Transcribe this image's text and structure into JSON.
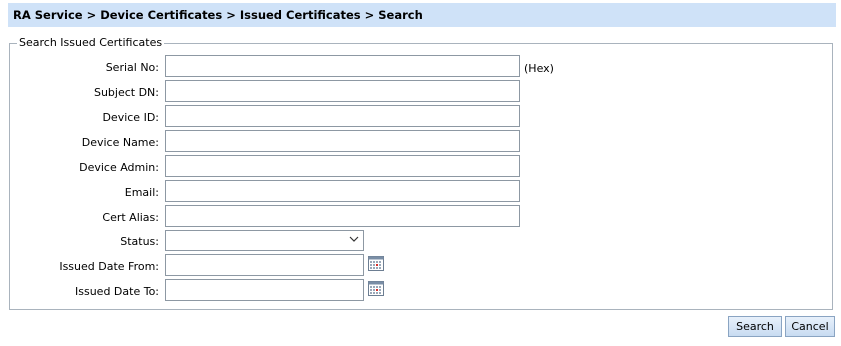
{
  "breadcrumb": "RA Service > Device Certificates > Issued Certificates > Search",
  "form": {
    "legend": "Search Issued Certificates",
    "serial_label": "Serial No:",
    "serial_value": "",
    "hex_note": "(Hex)",
    "subject_label": "Subject DN:",
    "subject_value": "",
    "device_id_label": "Device ID:",
    "device_id_value": "",
    "device_name_label": "Device Name:",
    "device_name_value": "",
    "device_admin_label": "Device Admin:",
    "device_admin_value": "",
    "email_label": "Email:",
    "email_value": "",
    "cert_alias_label": "Cert Alias:",
    "cert_alias_value": "",
    "status_label": "Status:",
    "status_value": "",
    "date_from_label": "Issued Date From:",
    "date_from_value": "",
    "date_to_label": "Issued Date To:",
    "date_to_value": ""
  },
  "buttons": {
    "search": "Search",
    "cancel": "Cancel"
  },
  "icons": {
    "calendar": "calendar-icon",
    "dropdown": "chevron-down-icon"
  },
  "colors": {
    "breadcrumb_bg": "#cfe2f8",
    "border": "#8d98a3"
  }
}
